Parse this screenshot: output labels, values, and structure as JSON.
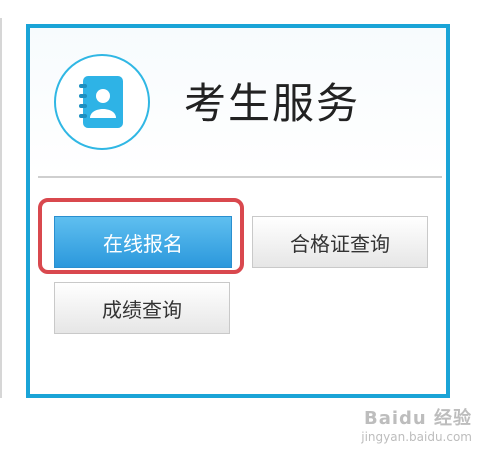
{
  "panel": {
    "title": "考生服务",
    "icon": "address-book-icon",
    "accent_color": "#1aa4d7"
  },
  "buttons": {
    "online_registration": "在线报名",
    "certificate_query": "合格证查询",
    "score_query": "成绩查询"
  },
  "highlight_color": "#d9484e",
  "watermark": {
    "brand": "Baidu 经验",
    "url": "jingyan.baidu.com"
  }
}
